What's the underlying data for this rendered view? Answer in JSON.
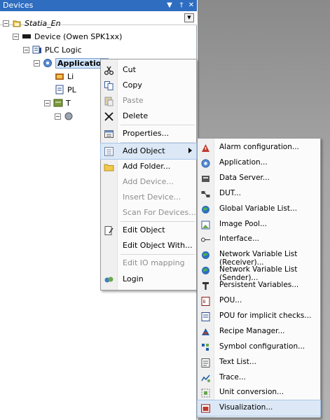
{
  "panel": {
    "title": "Devices",
    "pin_glyph": "↓",
    "pin2_glyph": "†",
    "close_glyph": "✕",
    "dropdown_glyph": "▼"
  },
  "tree": {
    "root": "Statia_En",
    "device": "Device (Owen SPK1xx)",
    "plc_logic": "PLC Logic",
    "application": "Application",
    "child1_stub": "Li",
    "child2_stub": "PL",
    "child3_stub": "T"
  },
  "context_menu": {
    "items": [
      {
        "label": "Cut",
        "icon": "scissors-icon",
        "enabled": true
      },
      {
        "label": "Copy",
        "icon": "copy-icon",
        "enabled": true
      },
      {
        "label": "Paste",
        "icon": "paste-icon",
        "enabled": false
      },
      {
        "label": "Delete",
        "icon": "delete-icon",
        "enabled": true
      },
      {
        "label": "Properties...",
        "icon": "properties-icon",
        "enabled": true
      },
      {
        "label": "Add Object",
        "icon": "add-object-icon",
        "enabled": true,
        "submenu": true
      },
      {
        "label": "Add Folder...",
        "icon": "folder-icon",
        "enabled": true
      },
      {
        "label": "Add Device...",
        "icon": "",
        "enabled": false
      },
      {
        "label": "Insert Device...",
        "icon": "",
        "enabled": false
      },
      {
        "label": "Scan For Devices...",
        "icon": "",
        "enabled": false
      },
      {
        "label": "Edit Object",
        "icon": "edit-object-icon",
        "enabled": true
      },
      {
        "label": "Edit Object With...",
        "icon": "",
        "enabled": true
      },
      {
        "label": "Edit IO mapping",
        "icon": "",
        "enabled": false
      },
      {
        "label": "Login",
        "icon": "login-icon",
        "enabled": true
      }
    ]
  },
  "submenu": {
    "items": [
      {
        "label": "Alarm configuration...",
        "icon": "alarm-icon"
      },
      {
        "label": "Application...",
        "icon": "application-icon"
      },
      {
        "label": "Data Server...",
        "icon": "data-server-icon"
      },
      {
        "label": "DUT...",
        "icon": "dut-icon"
      },
      {
        "label": "Global Variable List...",
        "icon": "globe-icon"
      },
      {
        "label": "Image Pool...",
        "icon": "image-pool-icon"
      },
      {
        "label": "Interface...",
        "icon": "interface-icon"
      },
      {
        "label": "Network Variable List (Receiver)...",
        "icon": "globe-icon"
      },
      {
        "label": "Network Variable List (Sender)...",
        "icon": "globe-icon"
      },
      {
        "label": "Persistent Variables...",
        "icon": "persistent-icon"
      },
      {
        "label": "POU...",
        "icon": "pou-icon"
      },
      {
        "label": "POU for implicit checks...",
        "icon": "pou-checks-icon"
      },
      {
        "label": "Recipe Manager...",
        "icon": "recipe-icon"
      },
      {
        "label": "Symbol configuration...",
        "icon": "symbol-icon"
      },
      {
        "label": "Text List...",
        "icon": "text-list-icon"
      },
      {
        "label": "Trace...",
        "icon": "trace-icon"
      },
      {
        "label": "Unit conversion...",
        "icon": "unit-conversion-icon"
      },
      {
        "label": "Visualization...",
        "icon": "visualization-icon"
      }
    ]
  }
}
